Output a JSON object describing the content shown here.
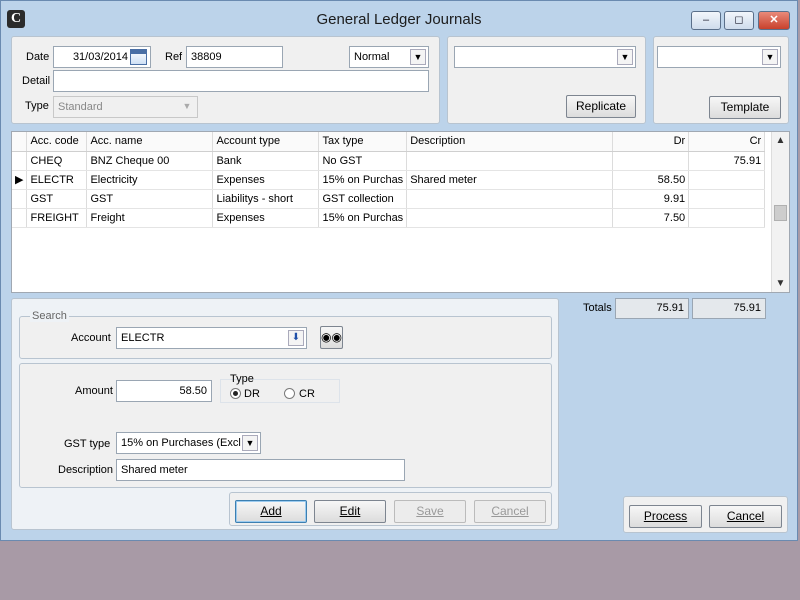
{
  "window": {
    "title": "General Ledger Journals",
    "app_icon": "C"
  },
  "header": {
    "date_label": "Date",
    "date_value": "31/03/2014",
    "ref_label": "Ref",
    "ref_value": "38809",
    "mode_value": "Normal",
    "detail_label": "Detail",
    "detail_value": "",
    "type_label": "Type",
    "type_value": "Standard",
    "replicate_label": "Replicate",
    "template_label": "Template"
  },
  "grid": {
    "columns": [
      "Acc. code",
      "Acc. name",
      "Account type",
      "Tax type",
      "Description",
      "Dr",
      "Cr"
    ],
    "rows": [
      {
        "code": "CHEQ",
        "name": "BNZ Cheque 00",
        "acctype": "Bank",
        "tax": "No GST",
        "desc": "",
        "dr": "",
        "cr": "75.91",
        "current": false
      },
      {
        "code": "ELECTR",
        "name": "Electricity",
        "acctype": "Expenses",
        "tax": "15% on Purchas",
        "desc": "Shared meter",
        "dr": "58.50",
        "cr": "",
        "current": true
      },
      {
        "code": "GST",
        "name": "GST",
        "acctype": "Liabilitys - short",
        "tax": "GST collection",
        "desc": "",
        "dr": "9.91",
        "cr": "",
        "current": false
      },
      {
        "code": "FREIGHT",
        "name": "Freight",
        "acctype": "Expenses",
        "tax": "15% on Purchas",
        "desc": "",
        "dr": "7.50",
        "cr": "",
        "current": false
      }
    ]
  },
  "search": {
    "legend": "Search",
    "account_label": "Account",
    "account_value": "ELECTR"
  },
  "entry": {
    "amount_label": "Amount",
    "amount_value": "58.50",
    "type_label": "Type",
    "dr_label": "DR",
    "cr_label": "CR",
    "gst_label": "GST type",
    "gst_value": "15% on Purchases (Excl",
    "desc_label": "Description",
    "desc_value": "Shared meter"
  },
  "actions": {
    "add": "Add",
    "edit": "Edit",
    "save": "Save",
    "cancel": "Cancel"
  },
  "totals": {
    "label": "Totals",
    "dr": "75.91",
    "cr": "75.91"
  },
  "footer": {
    "process": "Process",
    "cancel": "Cancel"
  }
}
